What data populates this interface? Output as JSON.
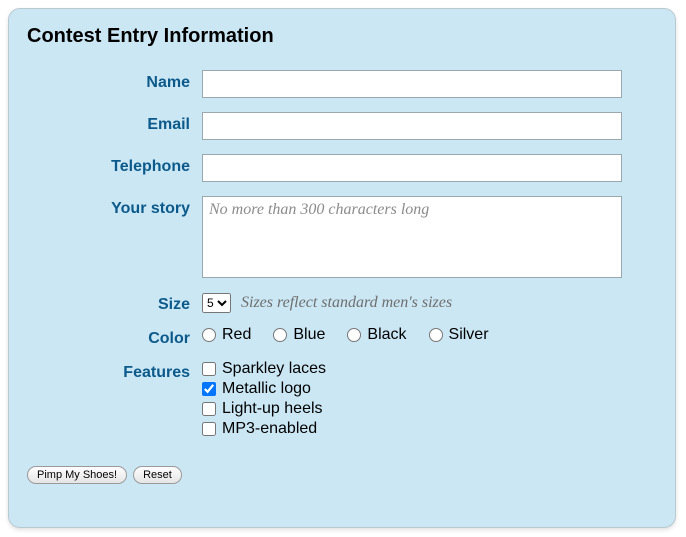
{
  "title": "Contest Entry Information",
  "fields": {
    "name_label": "Name",
    "email_label": "Email",
    "telephone_label": "Telephone",
    "story_label": "Your story",
    "story_placeholder": "No more than 300 characters long",
    "size_label": "Size",
    "size_value": "5",
    "size_hint": "Sizes reflect standard men's sizes",
    "color_label": "Color",
    "features_label": "Features"
  },
  "colors": {
    "red": "Red",
    "blue": "Blue",
    "black": "Black",
    "silver": "Silver"
  },
  "features": {
    "sparkley": "Sparkley laces",
    "metallic": "Metallic logo",
    "lightup": "Light-up heels",
    "mp3": "MP3-enabled"
  },
  "buttons": {
    "submit": "Pimp My Shoes!",
    "reset": "Reset"
  }
}
